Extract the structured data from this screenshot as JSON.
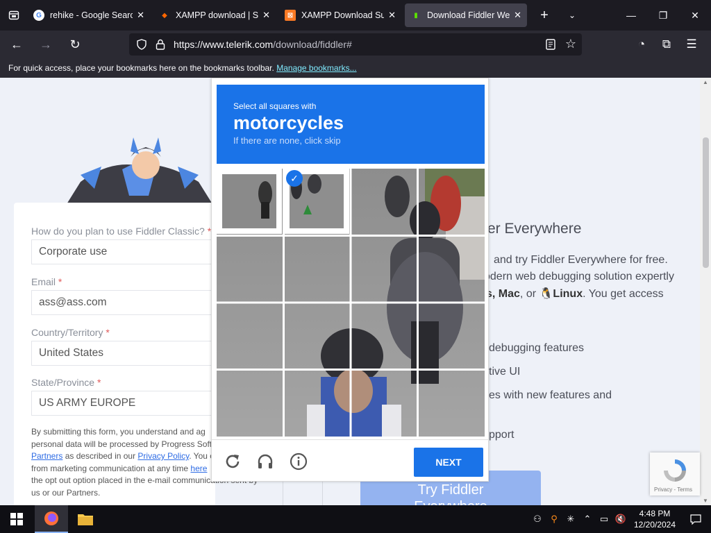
{
  "tabs": [
    {
      "title": "rehike - Google Search",
      "favicon": "G"
    },
    {
      "title": "XAMPP download | Sou",
      "favicon": "◆"
    },
    {
      "title": "XAMPP Download Succ",
      "favicon": "⊠"
    },
    {
      "title": "Download Fiddler Web",
      "favicon": "▮"
    }
  ],
  "url": {
    "host": "https://www.telerik.com",
    "path": "/download/fiddler#"
  },
  "bookmarks": {
    "text": "For quick access, place your bookmarks here on the bookmarks toolbar.",
    "link": "Manage bookmarks..."
  },
  "form": {
    "q1_label": "How do you plan to use Fiddler Classic?",
    "q1_value": "Corporate use",
    "email_label": "Email",
    "email_value": "ass@ass.com",
    "country_label": "Country/Territory",
    "country_value": "United States",
    "state_label": "State/Province",
    "state_value": "US ARMY EUROPE",
    "req": "*",
    "fine_1": "By submitting this form, you understand and ag",
    "fine_2": "personal data will be processed by Progress Soft",
    "fine_partners": "Partners",
    "fine_3": " as described in our ",
    "fine_privacy": "Privacy Policy",
    "fine_4": ". You c",
    "fine_5": "from marketing communication at any time ",
    "fine_here": "here",
    "fine_6": "the opt out option placed in the e-mail communication sent by",
    "fine_7": "us or our Partners."
  },
  "right": {
    "title": "er Everywhere",
    "l1": "and try Fiddler Everywhere for free.",
    "l2": "odern web debugging solution expertly",
    "l3_pre": "s,",
    "l3_mac": "Mac",
    "l3_mid": ", or",
    "l3_linux": "Linux",
    "l3_post": ". You get access",
    "l4": "debugging features",
    "l5": "tive UI",
    "l6": "es with new features and",
    "l7": "pport",
    "try_btn_1": "Try Fiddler",
    "try_btn_2": "Everywhere"
  },
  "captcha": {
    "line1": "Select all squares with",
    "line2": "motorcycles",
    "line3": "If there are none, click skip",
    "next": "NEXT"
  },
  "recaptcha_badge": "Privacy - Terms",
  "clock": {
    "time": "4:48 PM",
    "date": "12/20/2024"
  },
  "colors": {
    "accent": "#1a73e8",
    "tab_bar": "#1c1b22",
    "nav_bar": "#2b2a33"
  }
}
